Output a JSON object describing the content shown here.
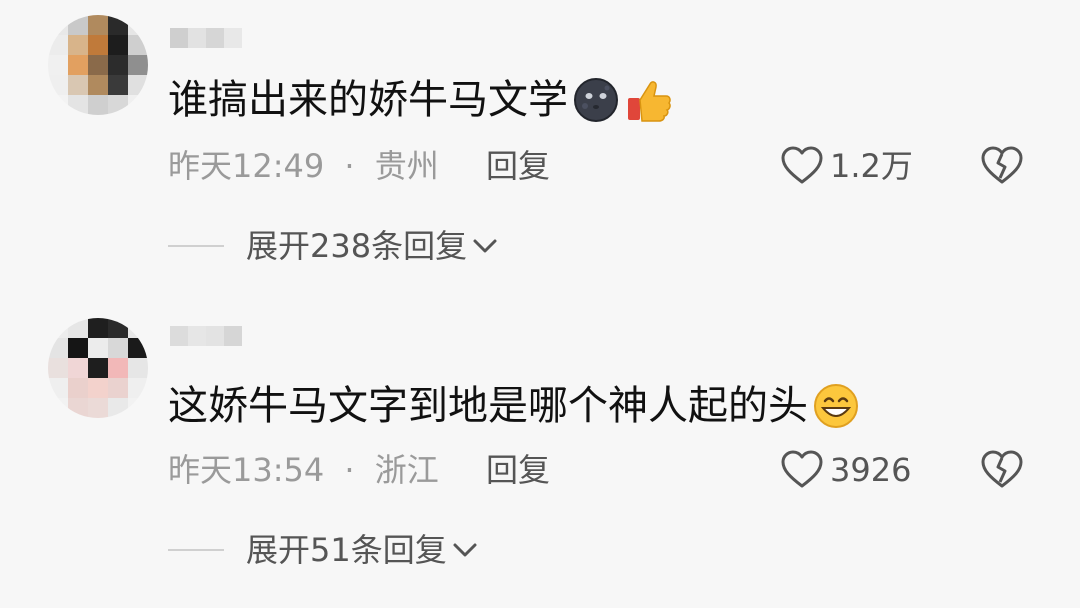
{
  "comments": [
    {
      "text": "谁搞出来的娇牛马文学",
      "emojis": [
        "new-moon-face-emoji",
        "thumbs-up-emoji"
      ],
      "time": "昨天12:49",
      "separator": "·",
      "location": "贵州",
      "reply_label": "回复",
      "likes": "1.2万",
      "expand_label": "展开238条回复"
    },
    {
      "text": "这娇牛马文字到地是哪个神人起的头",
      "emojis": [
        "grinning-face-emoji"
      ],
      "time": "昨天13:54",
      "separator": "·",
      "location": "浙江",
      "reply_label": "回复",
      "likes": "3926",
      "expand_label": "展开51条回复"
    }
  ]
}
